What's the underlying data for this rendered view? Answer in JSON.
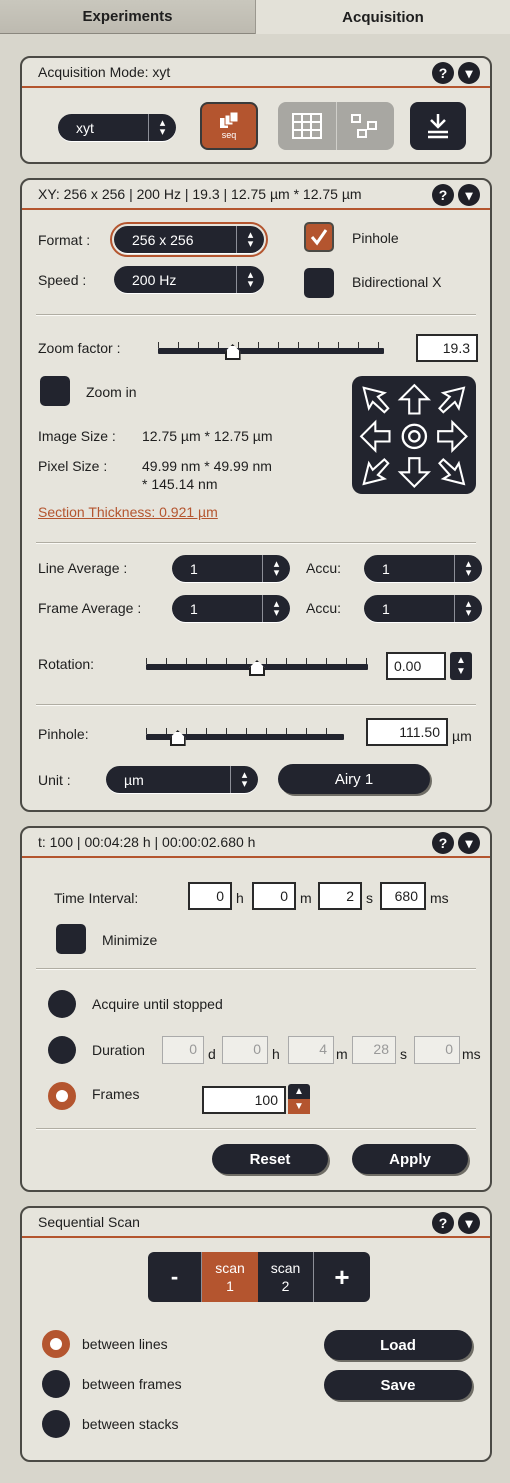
{
  "tabs": [
    {
      "label": "Experiments"
    },
    {
      "label": "Acquisition"
    }
  ],
  "acq_mode": {
    "title": "Acquisition Mode: xyt",
    "mode_value": "xyt",
    "seq_button": "seq"
  },
  "xy": {
    "title": "XY:  256 x 256 | 200 Hz | 19.3 | 12.75 µm * 12.75 µm",
    "format_label": "Format :",
    "format_value": "256 x 256",
    "speed_label": "Speed :",
    "speed_value": "200 Hz",
    "pinhole_check_label": "Pinhole",
    "bidir_label": "Bidirectional X",
    "zoom_label": "Zoom factor :",
    "zoom_value": "19.3",
    "zoom_in_label": "Zoom in",
    "image_size_label": "Image Size :",
    "image_size_value": "12.75 µm * 12.75 µm",
    "pixel_size_label": "Pixel Size :",
    "pixel_size_value_1": "49.99 nm * 49.99 nm",
    "pixel_size_value_2": "* 145.14 nm",
    "section_thickness": "Section Thickness: 0.921 µm",
    "line_avg_label": "Line Average :",
    "line_avg_value": "1",
    "accu_label_1": "Accu:",
    "accu_value_1": "1",
    "frame_avg_label": "Frame Average :",
    "frame_avg_value": "1",
    "accu_label_2": "Accu:",
    "accu_value_2": "1",
    "rotation_label": "Rotation:",
    "rotation_value": "0.00",
    "pinhole_label": "Pinhole:",
    "pinhole_value": "111.50",
    "pinhole_unit": "µm",
    "unit_label": "Unit :",
    "unit_value": "µm",
    "airy_button": "Airy 1",
    "zoom_level": 0.33,
    "rotation_level": 0.5,
    "pinhole_level": 0.16
  },
  "time": {
    "title": "t:    100  |   00:04:28 h   |   00:00:02.680 h",
    "interval_label": "Time Interval:",
    "h_value": "0",
    "h_unit": "h",
    "m_value": "0",
    "m_unit": "m",
    "s_value": "2",
    "s_unit": "s",
    "ms_value": "680",
    "ms_unit": "ms",
    "minimize_label": "Minimize",
    "acquire_label": "Acquire until stopped",
    "duration_label": "Duration",
    "dur_d": "0",
    "dur_d_unit": "d",
    "dur_h": "0",
    "dur_h_unit": "h",
    "dur_m": "4",
    "dur_m_unit": "m",
    "dur_s": "28",
    "dur_s_unit": "s",
    "dur_ms": "0",
    "dur_ms_unit": "ms",
    "frames_label": "Frames",
    "frames_value": "100",
    "reset_button": "Reset",
    "apply_button": "Apply"
  },
  "seq": {
    "title": "Sequential Scan",
    "minus": "-",
    "scan1_a": "scan",
    "scan1_b": "1",
    "scan2_a": "scan",
    "scan2_b": "2",
    "plus": "+",
    "between_lines": "between lines",
    "between_frames": "between frames",
    "between_stacks": "between stacks",
    "load_button": "Load",
    "save_button": "Save"
  },
  "colors": {
    "accent": "#b4552f",
    "dark": "#22242e",
    "panel": "#e6e4dc",
    "background": "#d8d6cc"
  },
  "icons": [
    "help-icon",
    "collapse-icon",
    "sequential-icon",
    "grid-icon",
    "tile-icon",
    "download-icon",
    "arrow-icons",
    "check-icon"
  ]
}
